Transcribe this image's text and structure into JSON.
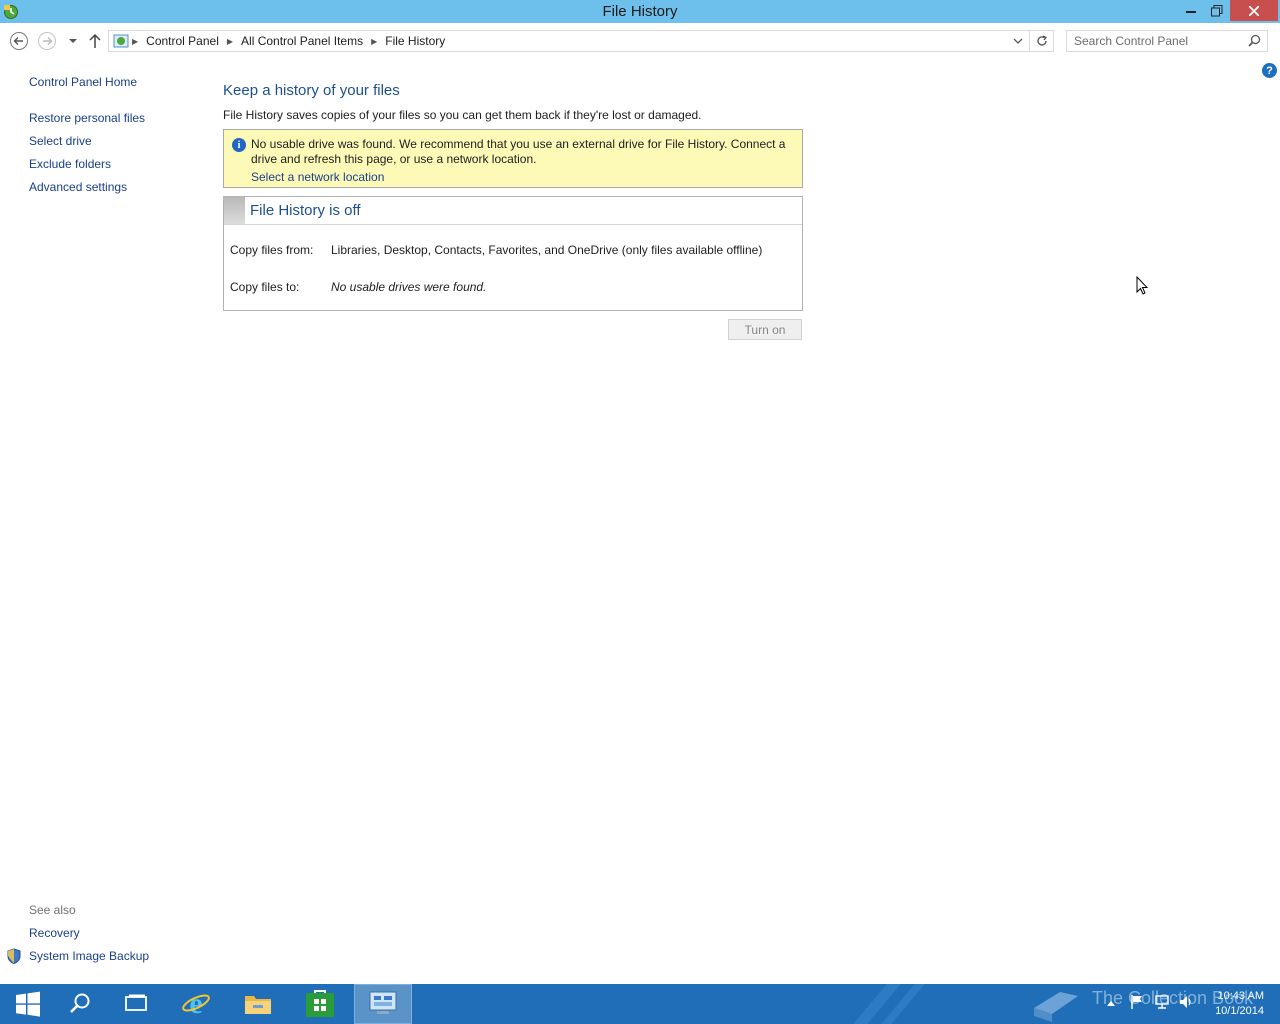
{
  "window": {
    "title": "File History"
  },
  "address": {
    "crumbs": [
      "Control Panel",
      "All Control Panel Items",
      "File History"
    ]
  },
  "search": {
    "placeholder": "Search Control Panel"
  },
  "sidebar": {
    "home": "Control Panel Home",
    "items": [
      {
        "label": "Restore personal files"
      },
      {
        "label": "Select drive"
      },
      {
        "label": "Exclude folders"
      },
      {
        "label": "Advanced settings"
      }
    ],
    "see_also_heading": "See also",
    "see_also": [
      {
        "label": "Recovery"
      },
      {
        "label": "System Image Backup"
      }
    ]
  },
  "main": {
    "title": "Keep a history of your files",
    "description": "File History saves copies of your files so you can get them back if they're lost or damaged.",
    "warning": {
      "message": "No usable drive was found. We recommend that you use an external drive for File History. Connect a drive and refresh this page, or use a network location.",
      "link": "Select a network location"
    },
    "status": {
      "title": "File History is off",
      "copy_from_label": "Copy files from:",
      "copy_from_value": "Libraries, Desktop, Contacts, Favorites, and OneDrive (only files available offline)",
      "copy_to_label": "Copy files to:",
      "copy_to_value": "No usable drives were found."
    },
    "turn_on_label": "Turn on"
  },
  "taskbar": {
    "watermark": "The Collection Book",
    "time": "10:43 AM",
    "date": "10/1/2014"
  },
  "colors": {
    "titlebar": "#6ec0ec",
    "close_button": "#c7504e",
    "taskbar": "#1f6eb7",
    "link": "#1a3f8c",
    "heading": "#1d4f91",
    "warning_bg": "#fdfab8"
  }
}
